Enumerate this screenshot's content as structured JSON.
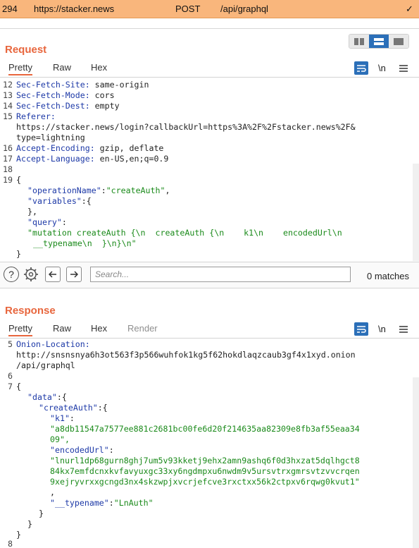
{
  "history_row": {
    "id": "294",
    "host": "https://stacker.news",
    "method": "POST",
    "url": "/api/graphql",
    "status_mark": "✓"
  },
  "request": {
    "title": "Request",
    "tabs": [
      "Pretty",
      "Raw",
      "Hex"
    ],
    "newline_toggle": "\\n",
    "lines": [
      {
        "num": "12",
        "key": "Sec-Fetch-Site:",
        "value": " same-origin"
      },
      {
        "num": "13",
        "key": "Sec-Fetch-Mode:",
        "value": " cors"
      },
      {
        "num": "14",
        "key": "Sec-Fetch-Dest:",
        "value": " empty"
      },
      {
        "num": "15",
        "key": "Referer:",
        "value": ""
      },
      {
        "num": "",
        "key": "",
        "value": "https://stacker.news/login?callbackUrl=https%3A%2F%2Fstacker.news%2F&"
      },
      {
        "num": "",
        "key": "",
        "value": "type=lightning"
      },
      {
        "num": "16",
        "key": "Accept-Encoding:",
        "value": " gzip, deflate"
      },
      {
        "num": "17",
        "key": "Accept-Language:",
        "value": " en-US,en;q=0.9"
      },
      {
        "num": "18",
        "key": "",
        "value": ""
      },
      {
        "num": "19",
        "key": "",
        "value": "{"
      }
    ],
    "body": {
      "operation_key": "\"operationName\"",
      "operation_value": "\"createAuth\"",
      "variables_key": "\"variables\"",
      "variables_open": ":{",
      "variables_close": "},",
      "query_key": "\"query\"",
      "query_line1": "\"mutation createAuth {\\n  createAuth {\\n    k1\\n    encodedUrl\\n",
      "query_line2": "__typename\\n  }\\n}\\n\"",
      "close": "}"
    }
  },
  "search": {
    "placeholder": "Search...",
    "matches": "0 matches"
  },
  "response": {
    "title": "Response",
    "tabs": [
      "Pretty",
      "Raw",
      "Hex",
      "Render"
    ],
    "newline_toggle": "\\n",
    "onion_num": "5",
    "onion_key": "Onion-Location:",
    "onion_value1": "http://snsnsnya6h3ot563f3p566wuhfok1kg5f62hokdlaqzcaub3gf4x1xyd.onion",
    "onion_value2": "/api/graphql",
    "n6": "6",
    "n7": "7",
    "n8": "8",
    "open_brace": "{",
    "data_key": "\"data\"",
    "create_key": "\"createAuth\"",
    "k1_key": "\"k1\"",
    "k1_value1": "\"a8db11547a7577ee881c2681bc00fe6d20f214635aa82309e8fb3af55eaa34",
    "k1_value2": "09\",",
    "encoded_key": "\"encodedUrl\"",
    "encoded_value1": "\"lnurl1dp68gurn8ghj7um5v93kketj9ehx2amn9ashq6f0d3hxzat5dqlhgct8",
    "encoded_value2": "84kx7emfdcnxkvfavyuxgc33xy6ngdmpxu6nwdm9v5ursvtrxgmrsvtzvvcrqen",
    "encoded_value3": "9xejryvrxxgcngd3nx4skzwpjxvcrjefcve3rxctxx56k2ctpxv6rqwg0kvut1\"",
    "encoded_comma": ",",
    "typename_key": "\"__typename\"",
    "typename_value": "\"LnAuth\"",
    "close_inner": "}",
    "close_data": "}",
    "close_outer": "}"
  }
}
